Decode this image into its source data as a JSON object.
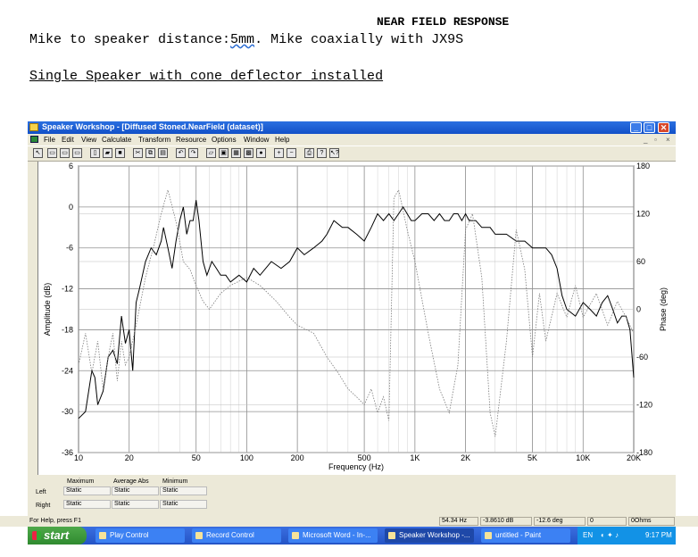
{
  "document": {
    "title": "NEAR FIELD RESPONSE",
    "line1_a": "Mike to speaker distance:",
    "line1_b": "5mm",
    "line1_c": ". Mike coaxially with JX9S",
    "line2": "Single Speaker with cone deflector installed"
  },
  "window": {
    "title": "Speaker Workshop - [Diffused Stoned.NearField (dataset)]",
    "menu": [
      "File",
      "Edit",
      "View",
      "Calculate",
      "Transform",
      "Resource",
      "Options",
      "Window",
      "Help"
    ]
  },
  "chart_data": {
    "type": "line",
    "xlabel": "Frequency (Hz)",
    "ylabel": "Amplitude (dB)",
    "y2label": "Phase (deg)",
    "xscale": "log",
    "xlim": [
      10,
      20000
    ],
    "ylim": [
      -36,
      6
    ],
    "y2lim": [
      -180,
      180
    ],
    "x_ticks": [
      "10",
      "20",
      "50",
      "100",
      "200",
      "500",
      "1K",
      "2K",
      "5K",
      "10K",
      "20K"
    ],
    "y_ticks": [
      "6",
      "0",
      "-6",
      "-12",
      "-18",
      "-24",
      "-30",
      "-36"
    ],
    "y2_ticks": [
      "180",
      "120",
      "60",
      "0",
      "-60",
      "-120",
      "-180"
    ],
    "grid": true,
    "series": [
      {
        "style": "solid",
        "axis": "amplitude",
        "x": [
          10,
          11,
          12,
          12.5,
          13,
          14,
          15,
          16,
          17,
          18,
          19,
          20,
          21,
          22,
          23,
          24,
          25,
          27,
          29,
          31,
          32,
          34,
          36,
          38,
          40,
          42,
          44,
          46,
          48,
          50,
          52,
          55,
          58,
          62,
          66,
          70,
          75,
          80,
          90,
          100,
          110,
          120,
          140,
          160,
          180,
          200,
          220,
          250,
          280,
          300,
          330,
          370,
          400,
          450,
          500,
          550,
          600,
          650,
          700,
          750,
          800,
          850,
          900,
          950,
          1000,
          1100,
          1200,
          1300,
          1400,
          1500,
          1600,
          1700,
          1800,
          1900,
          2000,
          2100,
          2300,
          2500,
          2800,
          3000,
          3500,
          4000,
          4500,
          5000,
          5500,
          6000,
          6500,
          7000,
          7500,
          8000,
          9000,
          10000,
          11000,
          12000,
          13000,
          14000,
          15000,
          16000,
          17000,
          18000,
          19000,
          20000
        ],
        "y": [
          -31,
          -30,
          -24,
          -25,
          -29,
          -27,
          -22,
          -21,
          -23,
          -16,
          -20,
          -18,
          -24,
          -14,
          -12,
          -10,
          -8,
          -6,
          -7,
          -5,
          -3,
          -6,
          -9,
          -5,
          -2,
          0,
          -4,
          -2,
          -2,
          1,
          -2,
          -8,
          -10,
          -8,
          -9,
          -10,
          -10,
          -11,
          -10,
          -11,
          -9,
          -10,
          -8,
          -9,
          -8,
          -6,
          -7,
          -6,
          -5,
          -4,
          -2,
          -3,
          -3,
          -4,
          -5,
          -3,
          -1,
          -2,
          -1,
          -2,
          -1,
          0,
          -1,
          -2,
          -2,
          -1,
          -1,
          -2,
          -1,
          -2,
          -2,
          -1,
          -1,
          -2,
          -1,
          -2,
          -2,
          -3,
          -3,
          -4,
          -4,
          -5,
          -5,
          -6,
          -6,
          -6,
          -7,
          -9,
          -13,
          -15,
          -16,
          -14,
          -15,
          -16,
          -14,
          -13,
          -15,
          -17,
          -16,
          -16,
          -18,
          -25
        ]
      },
      {
        "style": "dotted",
        "axis": "phase",
        "x": [
          10,
          11,
          12,
          13,
          14,
          15,
          16,
          17,
          18,
          19,
          20,
          22,
          25,
          28,
          31,
          34,
          38,
          42,
          46,
          50,
          55,
          60,
          70,
          80,
          100,
          120,
          150,
          180,
          200,
          250,
          300,
          350,
          400,
          450,
          500,
          550,
          600,
          650,
          700,
          750,
          800,
          900,
          1000,
          1200,
          1400,
          1600,
          1800,
          2000,
          2200,
          2500,
          2800,
          3000,
          3500,
          4000,
          4500,
          5000,
          5500,
          6000,
          7000,
          8000,
          9000,
          10000,
          12000,
          14000,
          16000,
          18000,
          20000
        ],
        "y": [
          -70,
          -30,
          -80,
          -40,
          -100,
          -60,
          -30,
          -90,
          -40,
          -70,
          -60,
          -20,
          40,
          80,
          120,
          150,
          110,
          60,
          50,
          30,
          10,
          0,
          20,
          30,
          40,
          30,
          10,
          -10,
          -20,
          -30,
          -60,
          -80,
          -100,
          -110,
          -120,
          -100,
          -130,
          -110,
          -140,
          140,
          150,
          100,
          60,
          -30,
          -100,
          -130,
          -70,
          100,
          120,
          40,
          -130,
          -160,
          -40,
          100,
          50,
          -60,
          20,
          -40,
          20,
          -10,
          30,
          -10,
          20,
          -20,
          10,
          -10,
          -30
        ]
      }
    ]
  },
  "bottom_panel": {
    "headers": [
      "Maximum",
      "Average Abs",
      "Minimum"
    ],
    "rows": [
      {
        "label": "Left",
        "values": [
          "Static",
          "Static",
          "Static"
        ]
      },
      {
        "label": "Right",
        "values": [
          "Static",
          "Static",
          "Static"
        ]
      }
    ]
  },
  "status": {
    "help": "For Help, press F1",
    "freq": "54.34 Hz",
    "db": "-3.8610 dB",
    "deg": "-12.6 deg",
    "zero": "0",
    "ohms": "0Ohms"
  },
  "taskbar": {
    "start": "start",
    "tasks": [
      "Play Control",
      "Record Control",
      "Microsoft Word - In-...",
      "Speaker Workshop -...",
      "untitled - Paint"
    ],
    "lang": "EN",
    "clock": "9:17 PM"
  },
  "colors": {
    "titlebar": "#1f5fd6",
    "chrome": "#ece9d8",
    "taskbar": "#2d5fd0",
    "start": "#3a9a3a"
  }
}
